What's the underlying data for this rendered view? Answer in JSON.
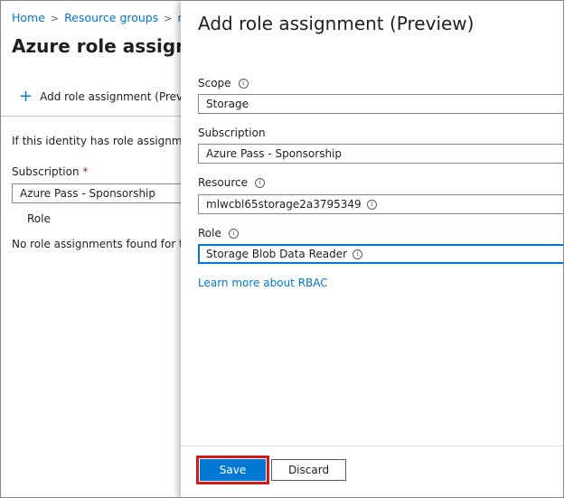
{
  "background_blade": {
    "breadcrumb": [
      "Home",
      "Resource groups",
      "rg"
    ],
    "title": "Azure role assignm",
    "add_button_label": "Add role assignment (Previe",
    "info_text": "If this identity has role assignmen",
    "subscription_label": "Subscription",
    "required_marker": "*",
    "subscription_value": "Azure Pass - Sponsorship",
    "role_column_header": "Role",
    "no_roles_text": "No role assignments found for th"
  },
  "panel": {
    "title": "Add role assignment (Preview)",
    "scope": {
      "label": "Scope",
      "value": "Storage"
    },
    "subscription": {
      "label": "Subscription",
      "value": "Azure Pass - Sponsorship"
    },
    "resource": {
      "label": "Resource",
      "value": "mlwcbl65storage2a3795349"
    },
    "role": {
      "label": "Role",
      "value": "Storage Blob Data Reader"
    },
    "rbac_link": "Learn more about RBAC",
    "save_label": "Save",
    "discard_label": "Discard"
  },
  "icons": {
    "info": "i",
    "plus": "+",
    "chevron": ">"
  },
  "colors": {
    "accent": "#0078d4",
    "highlight": "#d01b1b",
    "required": "#a4262c"
  }
}
